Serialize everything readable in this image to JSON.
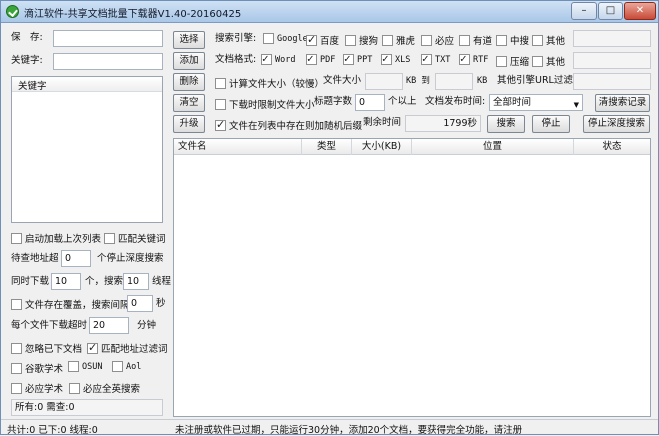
{
  "window": {
    "title": "滴江软件-共享文档批量下载器V1.40-20160425"
  },
  "left": {
    "save_label": "保　存:",
    "keyword_label": "关键字:",
    "keyword_list_header": "关键字",
    "options": {
      "auto_load": "启动加载上次列表",
      "match_keyword": "匹配关键词",
      "queue_label": "待查地址超",
      "queue_value": "0",
      "queue_suffix": "个停止深度搜索",
      "concurrent_label": "同时下载",
      "concurrent_value": "10",
      "concurrent_mid": "个，搜索",
      "search_value": "10",
      "search_suffix": "线程",
      "overwrite": "文件存在覆盖，搜索间隔",
      "interval_value": "0",
      "interval_unit": "秒",
      "timeout_label": "每个文件下载超时",
      "timeout_value": "20",
      "timeout_unit": "分钟",
      "ignore_downloaded": "忽略已下文档",
      "match_url_filter": "匹配地址过滤词",
      "google_scholar": "谷歌学术",
      "osun": "OSUN",
      "aol": "Aol",
      "bing_scholar": "必应学术",
      "bing_english": "必应全英搜索"
    },
    "status1": "所有:0 需查:0",
    "status2": "共计:0 已下:0 线程:0"
  },
  "toolbar": {
    "choose_button": "选择",
    "add_button": "添加",
    "delete_button": "删除",
    "clear_button": "清空",
    "upgrade_button": "升级",
    "search_engine_label": "搜索引擎:",
    "engines": [
      {
        "label": "Google",
        "checked": false
      },
      {
        "label": "百度",
        "checked": true
      },
      {
        "label": "搜狗",
        "checked": false
      },
      {
        "label": "雅虎",
        "checked": false
      },
      {
        "label": "必应",
        "checked": false
      },
      {
        "label": "有道",
        "checked": false
      },
      {
        "label": "中搜",
        "checked": false
      },
      {
        "label": "其他",
        "checked": false
      }
    ],
    "format_label": "文档格式:",
    "formats": [
      {
        "label": "Word",
        "checked": true
      },
      {
        "label": "PDF",
        "checked": true
      },
      {
        "label": "PPT",
        "checked": true
      },
      {
        "label": "XLS",
        "checked": true
      },
      {
        "label": "TXT",
        "checked": true
      },
      {
        "label": "RTF",
        "checked": true
      },
      {
        "label": "压缩",
        "checked": false
      },
      {
        "label": "其他",
        "checked": false
      }
    ],
    "calc_size_label": "计算文件大小（较慢）",
    "file_size_label": "文件大小",
    "kb_to": "KB 到",
    "kb": "KB",
    "other_engine_filter": "其他引擎URL过滤",
    "download_limit_label": "下载时限制文件大小",
    "title_chars_label": "标题字数",
    "title_chars_value": "0",
    "title_chars_suffix": "个以上",
    "publish_time_label": "文档发布时间:",
    "publish_time_value": "全部时间",
    "clear_search_button": "清搜索记录",
    "random_delay_label": "文件在列表中存在则加随机后缀",
    "remaining_label": "剩余时间",
    "remaining_value": "1799秒",
    "search_button": "搜索",
    "stop_button": "停止",
    "stop_deep_button": "停止深度搜索"
  },
  "table": {
    "columns": [
      "文件名",
      "类型",
      "大小(KB)",
      "位置",
      "状态"
    ]
  },
  "footer": {
    "message": "未注册或软件已过期，只能运行30分钟，添加20个文档，要获得完全功能，请注册"
  }
}
